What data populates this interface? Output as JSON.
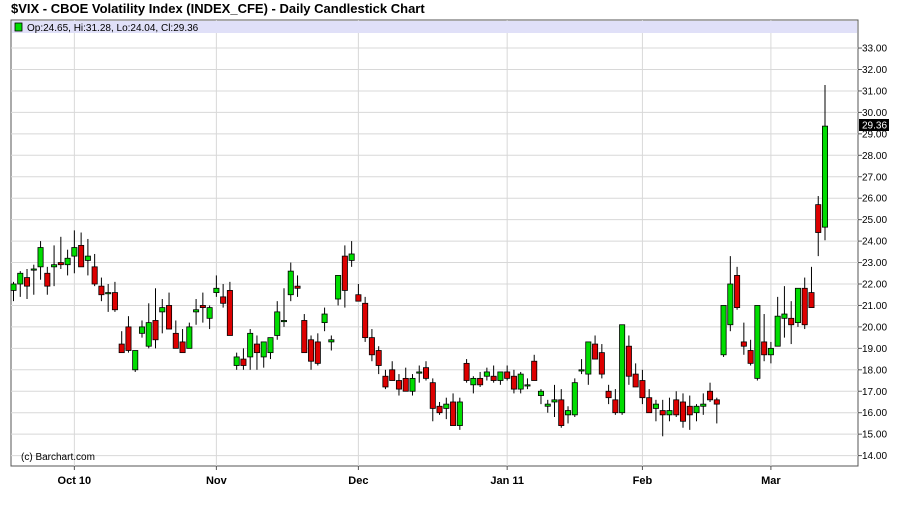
{
  "chart_data": {
    "type": "candlestick",
    "title": "$VIX - CBOE Volatility Index (INDEX_CFE) - Daily Candlestick Chart",
    "legend": {
      "text": "Op:24.65, Hi:31.28, Lo:24.04, Cl:29.36",
      "placement": "top-left"
    },
    "credit": "(c) Barchart.com",
    "last_value_label": "29.36",
    "ylim": [
      13.5,
      33.5
    ],
    "y_ticks": [
      "14.00",
      "15.00",
      "16.00",
      "17.00",
      "18.00",
      "19.00",
      "20.00",
      "21.00",
      "22.00",
      "23.00",
      "24.00",
      "25.00",
      "26.00",
      "27.00",
      "28.00",
      "29.00",
      "30.00",
      "31.00",
      "32.00",
      "33.00"
    ],
    "y_axis_side": "right",
    "grid": true,
    "x_labels": [
      {
        "label": "Oct 10",
        "index": 9
      },
      {
        "label": "Nov",
        "index": 30
      },
      {
        "label": "Dec",
        "index": 51
      },
      {
        "label": "Jan 11",
        "index": 73
      },
      {
        "label": "Feb",
        "index": 93
      },
      {
        "label": "Mar",
        "index": 112
      }
    ],
    "colors": {
      "up": "#00dd00",
      "down": "#dd0000",
      "wick": "#000000",
      "legend_bg": "#e0e0f8",
      "last_label_bg": "#000000"
    },
    "candles": [
      [
        21.7,
        22.1,
        21.2,
        22.0
      ],
      [
        22.0,
        22.6,
        21.4,
        22.5
      ],
      [
        22.3,
        22.7,
        21.3,
        21.9
      ],
      [
        22.7,
        22.9,
        21.5,
        22.7
      ],
      [
        22.8,
        24.0,
        22.2,
        23.7
      ],
      [
        22.5,
        22.8,
        21.5,
        21.9
      ],
      [
        22.8,
        23.8,
        21.9,
        22.9
      ],
      [
        23.0,
        24.2,
        22.7,
        22.9
      ],
      [
        22.9,
        23.6,
        22.4,
        23.2
      ],
      [
        23.3,
        24.5,
        22.5,
        23.7
      ],
      [
        23.8,
        24.4,
        22.9,
        22.8
      ],
      [
        23.1,
        24.1,
        22.4,
        23.3
      ],
      [
        22.8,
        23.4,
        21.9,
        22.0
      ],
      [
        21.9,
        22.3,
        21.2,
        21.5
      ],
      [
        21.6,
        22.0,
        20.7,
        21.6
      ],
      [
        21.6,
        22.1,
        20.7,
        20.8
      ],
      [
        19.2,
        19.8,
        18.8,
        18.8
      ],
      [
        20.0,
        20.5,
        18.8,
        18.9
      ],
      [
        18.0,
        18.8,
        17.9,
        18.9
      ],
      [
        19.7,
        20.3,
        19.5,
        20.0
      ],
      [
        19.1,
        21.1,
        19.0,
        20.2
      ],
      [
        20.3,
        21.8,
        19.0,
        19.4
      ],
      [
        20.7,
        21.3,
        19.7,
        20.9
      ],
      [
        21.0,
        21.6,
        20.0,
        19.9
      ],
      [
        19.7,
        20.3,
        19.3,
        19.0
      ],
      [
        19.3,
        19.9,
        18.9,
        18.8
      ],
      [
        19.0,
        20.2,
        19.0,
        20.0
      ],
      [
        20.7,
        21.3,
        20.1,
        20.8
      ],
      [
        21.0,
        21.6,
        20.2,
        20.9
      ],
      [
        20.4,
        21.0,
        19.9,
        20.9
      ],
      [
        21.6,
        22.4,
        21.4,
        21.8
      ],
      [
        21.4,
        22.0,
        20.9,
        21.1
      ],
      [
        21.7,
        22.1,
        19.6,
        19.6
      ],
      [
        18.2,
        18.8,
        18.0,
        18.6
      ],
      [
        18.5,
        19.0,
        18.0,
        18.2
      ],
      [
        18.6,
        19.9,
        18.0,
        19.7
      ],
      [
        19.2,
        19.6,
        18.0,
        18.8
      ],
      [
        18.6,
        19.1,
        18.1,
        19.3
      ],
      [
        18.8,
        19.4,
        18.5,
        19.5
      ],
      [
        19.6,
        21.2,
        19.4,
        20.7
      ],
      [
        20.3,
        21.8,
        20.0,
        20.3
      ],
      [
        21.5,
        23.0,
        21.2,
        22.6
      ],
      [
        21.9,
        22.4,
        21.4,
        21.8
      ],
      [
        20.3,
        20.6,
        18.8,
        18.8
      ],
      [
        19.4,
        19.6,
        18.0,
        18.4
      ],
      [
        19.3,
        19.7,
        18.2,
        18.3
      ],
      [
        20.2,
        20.9,
        19.8,
        20.6
      ],
      [
        19.3,
        19.6,
        18.9,
        19.4
      ],
      [
        21.3,
        22.0,
        21.0,
        22.4
      ],
      [
        23.3,
        23.8,
        20.9,
        21.7
      ],
      [
        23.1,
        24.0,
        22.8,
        23.4
      ],
      [
        21.5,
        22.0,
        21.2,
        21.2
      ],
      [
        21.1,
        21.4,
        19.3,
        19.5
      ],
      [
        19.5,
        19.9,
        18.4,
        18.7
      ],
      [
        18.9,
        19.1,
        17.8,
        18.2
      ],
      [
        17.7,
        18.0,
        17.1,
        17.2
      ],
      [
        18.0,
        18.4,
        17.5,
        17.5
      ],
      [
        17.5,
        17.8,
        16.8,
        17.1
      ],
      [
        17.6,
        18.1,
        17.1,
        17.0
      ],
      [
        17.0,
        17.8,
        16.8,
        17.6
      ],
      [
        17.9,
        18.2,
        17.4,
        17.9
      ],
      [
        18.1,
        18.4,
        17.5,
        17.6
      ],
      [
        17.4,
        17.6,
        15.6,
        16.2
      ],
      [
        16.3,
        16.5,
        15.9,
        16.0
      ],
      [
        16.2,
        16.7,
        15.7,
        16.4
      ],
      [
        16.5,
        16.9,
        15.6,
        15.4
      ],
      [
        15.4,
        16.7,
        15.2,
        16.5
      ],
      [
        18.3,
        18.5,
        17.4,
        17.5
      ],
      [
        17.3,
        17.7,
        16.9,
        17.6
      ],
      [
        17.6,
        17.9,
        17.2,
        17.3
      ],
      [
        17.7,
        18.1,
        17.5,
        17.9
      ],
      [
        17.7,
        18.2,
        17.4,
        17.5
      ],
      [
        17.5,
        17.9,
        17.3,
        17.9
      ],
      [
        17.9,
        18.2,
        17.5,
        17.6
      ],
      [
        17.7,
        18.0,
        16.9,
        17.1
      ],
      [
        17.1,
        17.9,
        16.9,
        17.8
      ],
      [
        17.3,
        17.6,
        17.1,
        17.3
      ],
      [
        18.4,
        18.7,
        17.5,
        17.5
      ],
      [
        16.8,
        17.1,
        16.4,
        17.0
      ],
      [
        16.3,
        16.6,
        16.0,
        16.4
      ],
      [
        16.5,
        17.3,
        15.8,
        16.6
      ],
      [
        16.6,
        17.1,
        15.3,
        15.4
      ],
      [
        15.9,
        16.3,
        15.5,
        16.1
      ],
      [
        15.9,
        17.6,
        15.8,
        17.4
      ],
      [
        18.0,
        18.5,
        17.8,
        18.0
      ],
      [
        17.8,
        19.3,
        17.3,
        19.3
      ],
      [
        19.2,
        19.6,
        18.5,
        18.5
      ],
      [
        18.8,
        19.2,
        17.6,
        17.8
      ],
      [
        17.0,
        17.3,
        16.4,
        16.7
      ],
      [
        16.6,
        17.1,
        15.9,
        16.0
      ],
      [
        16.0,
        20.1,
        15.9,
        20.1
      ],
      [
        19.1,
        19.6,
        17.3,
        17.7
      ],
      [
        17.8,
        18.3,
        17.3,
        17.2
      ],
      [
        17.5,
        18.0,
        16.4,
        16.7
      ],
      [
        16.7,
        17.1,
        16.0,
        16.0
      ],
      [
        16.2,
        16.6,
        15.6,
        16.4
      ],
      [
        16.1,
        16.6,
        14.9,
        15.9
      ],
      [
        15.9,
        16.7,
        15.6,
        16.1
      ],
      [
        16.6,
        17.0,
        15.8,
        15.9
      ],
      [
        16.5,
        16.9,
        15.3,
        15.6
      ],
      [
        16.3,
        16.8,
        15.2,
        15.9
      ],
      [
        16.0,
        16.4,
        15.6,
        16.3
      ],
      [
        16.3,
        16.9,
        15.9,
        16.4
      ],
      [
        17.0,
        17.4,
        16.5,
        16.6
      ],
      [
        16.6,
        16.7,
        15.5,
        16.4
      ],
      [
        18.7,
        21.0,
        18.6,
        21.0
      ],
      [
        20.1,
        23.3,
        19.8,
        22.0
      ],
      [
        22.4,
        22.8,
        20.8,
        20.9
      ],
      [
        19.3,
        20.2,
        18.7,
        19.1
      ],
      [
        18.9,
        19.4,
        18.2,
        18.3
      ],
      [
        17.6,
        21.0,
        17.5,
        21.0
      ],
      [
        19.3,
        20.6,
        18.4,
        18.7
      ],
      [
        18.7,
        19.3,
        18.3,
        19.0
      ],
      [
        19.1,
        21.4,
        19.1,
        20.5
      ],
      [
        20.4,
        21.9,
        19.5,
        20.6
      ],
      [
        20.4,
        21.2,
        19.2,
        20.1
      ],
      [
        20.2,
        21.5,
        20.0,
        21.8
      ],
      [
        21.8,
        22.3,
        19.9,
        20.1
      ],
      [
        21.6,
        22.8,
        21.0,
        20.9
      ],
      [
        25.7,
        26.1,
        23.3,
        24.4
      ],
      [
        24.65,
        31.28,
        24.04,
        29.36
      ]
    ]
  }
}
